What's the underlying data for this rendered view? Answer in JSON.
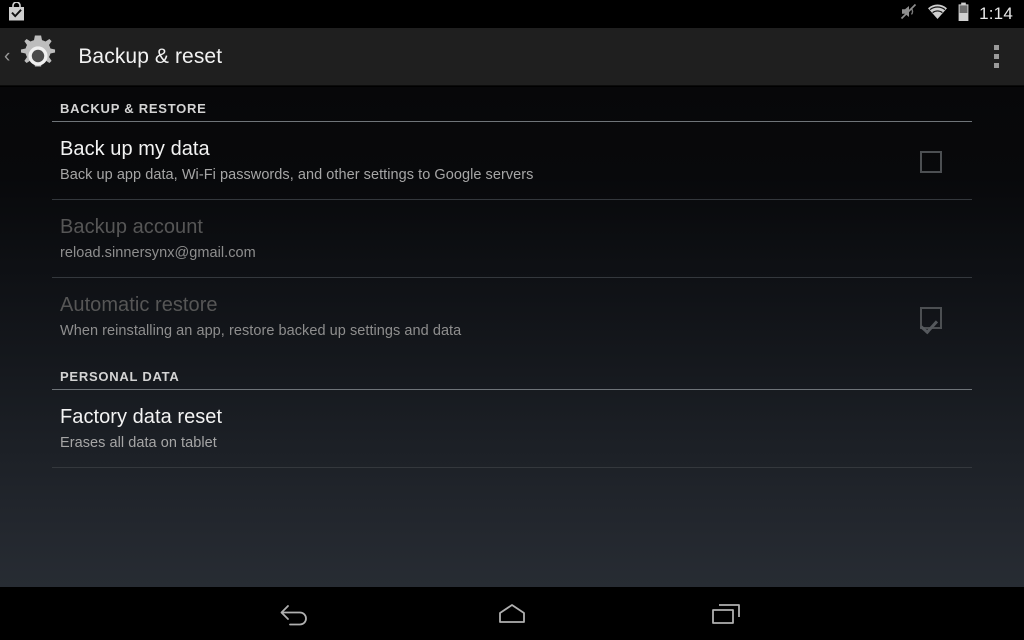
{
  "status_bar": {
    "notification_icon": "play-store-installed-icon",
    "icons": [
      "volume-mute-icon",
      "wifi-icon",
      "battery-icon"
    ],
    "time": "1:14"
  },
  "action_bar": {
    "up_icon": "back-chevron-icon",
    "app_icon": "settings-gear-icon",
    "title": "Backup & reset",
    "overflow_icon": "overflow-menu-icon"
  },
  "sections": [
    {
      "header": "BACKUP & RESTORE",
      "items": [
        {
          "title": "Back up my data",
          "summary": "Back up app data, Wi-Fi passwords, and other settings to Google servers",
          "widget": "checkbox",
          "checked": false,
          "enabled": true
        },
        {
          "title": "Backup account",
          "summary": "reload.sinnersynx@gmail.com",
          "widget": "none",
          "checked": false,
          "enabled": false
        },
        {
          "title": "Automatic restore",
          "summary": "When reinstalling an app, restore backed up settings and data",
          "widget": "checkbox",
          "checked": true,
          "enabled": false
        }
      ]
    },
    {
      "header": "PERSONAL DATA",
      "items": [
        {
          "title": "Factory data reset",
          "summary": "Erases all data on tablet",
          "widget": "none",
          "checked": false,
          "enabled": true
        }
      ]
    }
  ],
  "nav_bar": {
    "back": "back-nav-icon",
    "home": "home-nav-icon",
    "recents": "recent-apps-nav-icon"
  },
  "colors": {
    "action_bar_bg": "#1f1f1f",
    "text_primary": "#f3f3f3",
    "text_secondary": "#a6a6a6",
    "text_disabled": "#565656",
    "divider": "#34383d",
    "header_rule": "#6f7479"
  }
}
